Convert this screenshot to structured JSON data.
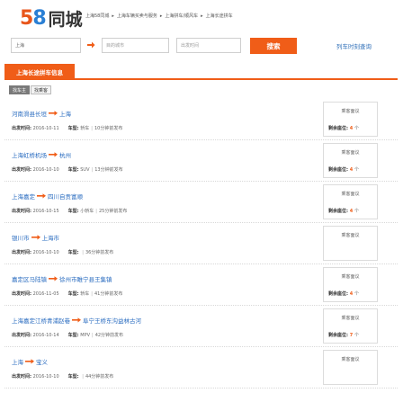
{
  "header": {
    "logo_num1": "5",
    "logo_num2": "8",
    "logo_text": "同城",
    "breadcrumbs": [
      "上海58同城",
      "上海车辆买卖与服务",
      "上海拼车/顺风车",
      "上海长途拼车"
    ]
  },
  "search": {
    "from_value": "上海",
    "to_placeholder": "目的城市",
    "date_placeholder": "出发时间",
    "button_label": "搜索",
    "train_link": "列车时刻查询"
  },
  "tabs": {
    "active_label": "上海长途拼车信息",
    "subtabs": [
      "找车主",
      "找乘客"
    ]
  },
  "labels": {
    "depart": "出发时间:",
    "car_type": "车型:",
    "seat_tag": "乘客面议",
    "seats_left": "剩余座位:",
    "unit": "个"
  },
  "listings": [
    {
      "from": "河南滑县长垣",
      "to": "上海",
      "date": "2016-10-11",
      "car": "轿车",
      "posted": "10分钟前发布",
      "seats": "4"
    },
    {
      "from": "上海虹桥机场",
      "to": "杭州",
      "date": "2016-10-10",
      "car": "SUV",
      "posted": "13分钟前发布",
      "seats": "4"
    },
    {
      "from": "上海嘉定",
      "to": "四川自贡富顺",
      "date": "2016-10-15",
      "car": "小轿车",
      "posted": "25分钟前发布",
      "seats": "4"
    },
    {
      "from": "银川市",
      "to": "上海市",
      "date": "2016-10-10",
      "car": "",
      "posted": "36分钟前发布",
      "seats": ""
    },
    {
      "from": "嘉定区马陆镇",
      "to": "徐州市睢宁县王集镇",
      "date": "2016-11-05",
      "car": "轿车",
      "posted": "41分钟前发布",
      "seats": "4"
    },
    {
      "from": "上海嘉定江桥青浦赵巷",
      "to": "阜宁王桥东沟益林古河",
      "date": "2016-10-14",
      "car": "MPV",
      "posted": "42分钟前发布",
      "seats": "7"
    },
    {
      "from": "上海",
      "to": "宝义",
      "date": "2016-10-10",
      "car": "",
      "posted": "44分钟前发布",
      "seats": ""
    }
  ],
  "colors": {
    "accent": "#f05d18",
    "link": "#2a6cc0"
  }
}
